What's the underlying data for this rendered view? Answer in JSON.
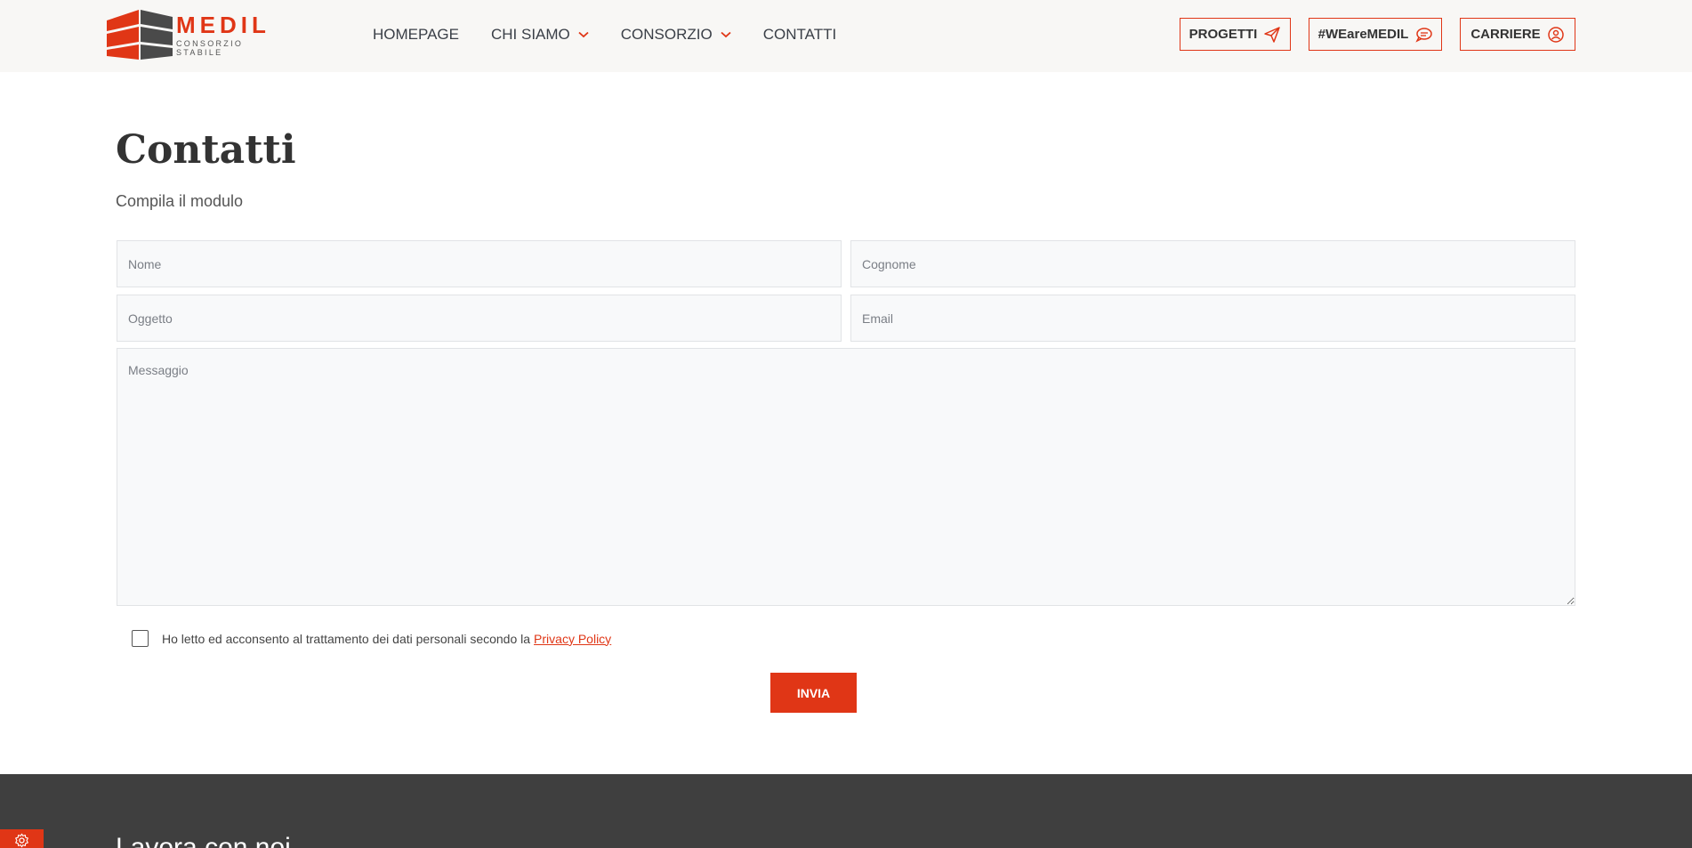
{
  "brand": {
    "name": "MEDIL",
    "tagline": "CONSORZIO STABILE",
    "accent": "#e03616",
    "dark": "#4a4a4a"
  },
  "nav": {
    "items": [
      {
        "label": "HOMEPAGE",
        "has_dropdown": false
      },
      {
        "label": "CHI SIAMO",
        "has_dropdown": true
      },
      {
        "label": "CONSORZIO",
        "has_dropdown": true
      },
      {
        "label": "CONTATTI",
        "has_dropdown": false
      }
    ]
  },
  "header_buttons": [
    {
      "label": "PROGETTI",
      "icon": "paper-plane-icon"
    },
    {
      "label": "#WEareMEDIL",
      "icon": "chat-bubbles-icon"
    },
    {
      "label": "CARRIERE",
      "icon": "user-badge-icon"
    }
  ],
  "page": {
    "title": "Contatti",
    "subtitle": "Compila il modulo"
  },
  "form": {
    "nome_placeholder": "Nome",
    "cognome_placeholder": "Cognome",
    "oggetto_placeholder": "Oggetto",
    "email_placeholder": "Email",
    "messaggio_placeholder": "Messaggio",
    "consent_text": "Ho letto ed acconsento al trattamento dei dati personali secondo la",
    "privacy_link": "Privacy Policy",
    "consent_checked": false,
    "submit_label": "INVIA"
  },
  "footer": {
    "heading": "Lavora con noi",
    "arrow": "→",
    "background": "#3f3f3f"
  },
  "cookie_settings": {
    "icon": "gear-icon"
  }
}
